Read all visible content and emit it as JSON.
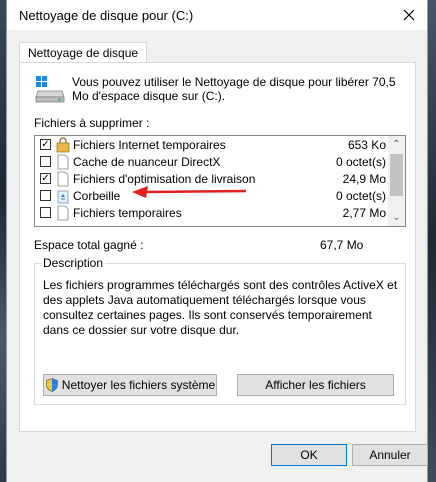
{
  "window": {
    "title": "Nettoyage de disque pour  (C:)"
  },
  "tab": {
    "label": "Nettoyage de disque"
  },
  "intro": {
    "text": "Vous pouvez utiliser le Nettoyage de disque pour libérer 70,5 Mo d'espace disque sur  (C:)."
  },
  "files": {
    "label": "Fichiers à supprimer :",
    "items": [
      {
        "name": "Fichiers Internet temporaires",
        "size": "653 Ko",
        "checked": true,
        "icon": "lock-folder-icon"
      },
      {
        "name": "Cache de nuanceur DirectX",
        "size": "0 octet(s)",
        "checked": false,
        "icon": "file-icon"
      },
      {
        "name": "Fichiers d'optimisation de livraison",
        "size": "24,9 Mo",
        "checked": true,
        "icon": "file-icon"
      },
      {
        "name": "Corbeille",
        "size": "0 octet(s)",
        "checked": false,
        "icon": "recycle-bin-icon"
      },
      {
        "name": "Fichiers temporaires",
        "size": "2,77 Mo",
        "checked": false,
        "icon": "file-icon"
      }
    ]
  },
  "total": {
    "label": "Espace total gagné :",
    "value": "67,7 Mo"
  },
  "description": {
    "legend": "Description",
    "text": "Les fichiers programmes téléchargés sont des contrôles ActiveX et des applets Java automatiquement téléchargés lorsque vous consultez certaines pages. Ils sont conservés temporairement dans ce dossier sur votre disque dur."
  },
  "buttons": {
    "clean_system": "Nettoyer les fichiers système",
    "view_files": "Afficher les fichiers",
    "ok": "OK",
    "cancel": "Annuler"
  },
  "colors": {
    "accent": "#0078d7",
    "arrow": "#e02020"
  }
}
